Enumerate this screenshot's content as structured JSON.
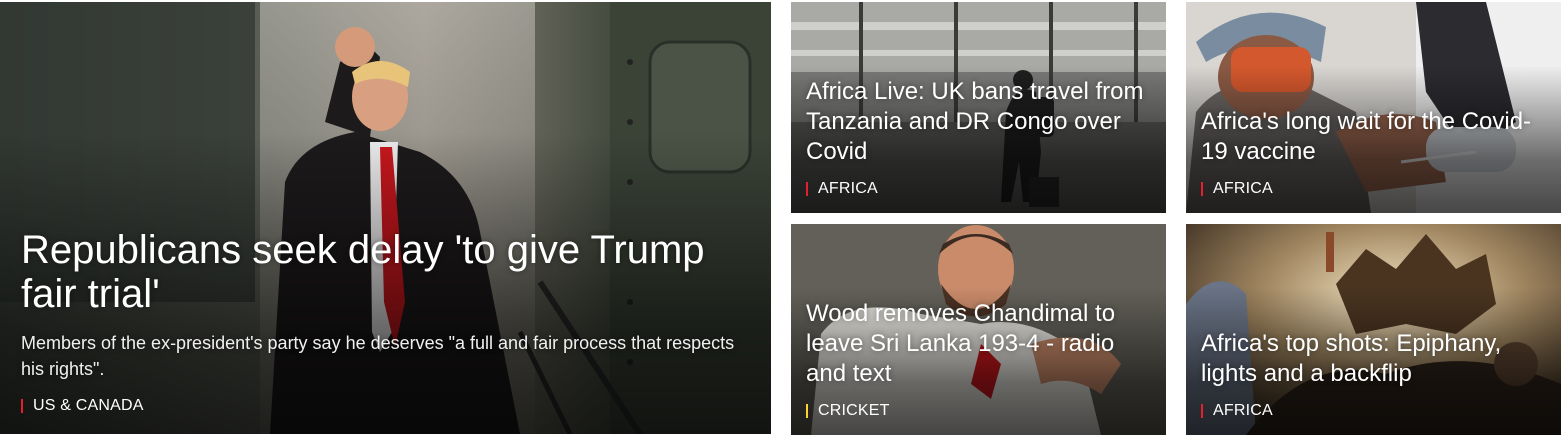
{
  "hero": {
    "headline": "Republicans seek delay 'to give Trump fair trial'",
    "summary": "Members of the ex-president's party say he deserves \"a full and fair process that respects his rights\".",
    "section": "US & CANADA",
    "section_color": "#e3202b"
  },
  "cards": [
    {
      "headline": "Africa Live: UK bans travel from Tanzania and DR Congo over Covid",
      "section": "AFRICA",
      "section_color": "#e3202b"
    },
    {
      "headline": "Africa's long wait for the Covid-19 vaccine",
      "section": "AFRICA",
      "section_color": "#e3202b"
    },
    {
      "headline": "Wood removes Chandimal to leave Sri Lanka 193-4 - radio and text",
      "section": "CRICKET",
      "section_color": "#ffd230"
    },
    {
      "headline": "Africa's top shots: Epiphany, lights and a backflip",
      "section": "AFRICA",
      "section_color": "#e3202b"
    }
  ]
}
